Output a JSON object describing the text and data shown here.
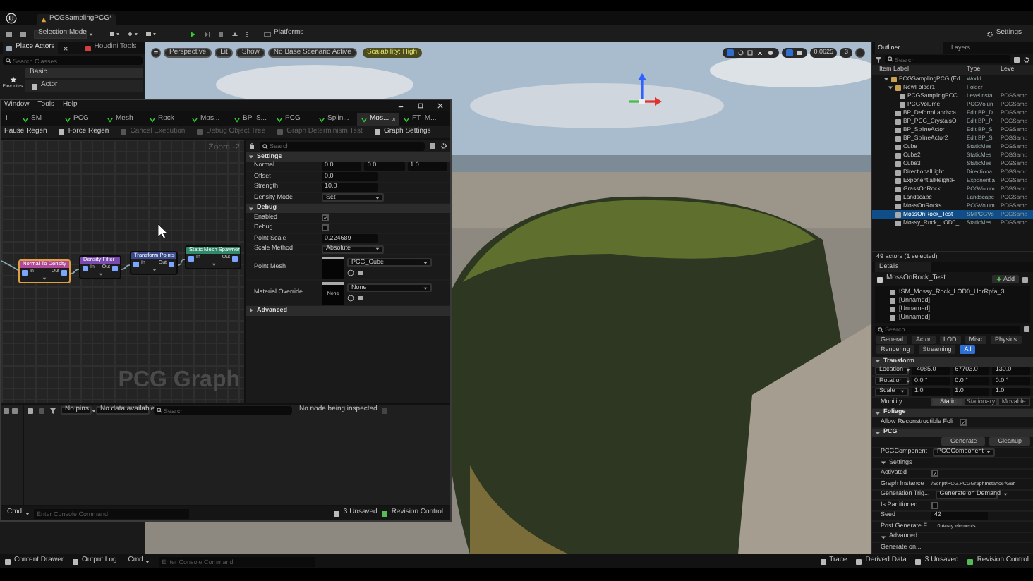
{
  "title_tab": "PCGSamplingPCG*",
  "toolbar": {
    "mode": "Selection Mode",
    "platforms": "Platforms",
    "settings": "Settings"
  },
  "place_actors": {
    "tabs": [
      {
        "label": "Place Actors",
        "selected": true
      },
      {
        "label": "Houdini Tools",
        "selected": false
      }
    ],
    "search": {
      "placeholder": "Search Classes"
    },
    "favorites": "Favorites",
    "category": "Basic",
    "item": "Actor"
  },
  "viewport": {
    "pills": [
      "Perspective",
      "Lit",
      "Show",
      "No Base Scenario Active"
    ],
    "scalability": "Scalability: High",
    "snap": "0.0625",
    "camera_speed": "3"
  },
  "pcg_window": {
    "menu": [
      "Window",
      "Tools",
      "Help"
    ],
    "tabs": [
      {
        "label": "I_",
        "selected": false
      },
      {
        "label": "SM_",
        "selected": false
      },
      {
        "label": "PCG_",
        "selected": false
      },
      {
        "label": "Mesh",
        "selected": false
      },
      {
        "label": "Rock",
        "selected": false
      },
      {
        "label": "Mos...",
        "selected": false
      },
      {
        "label": "BP_S...",
        "selected": false
      },
      {
        "label": "PCG_",
        "selected": false
      },
      {
        "label": "Splin...",
        "selected": false
      },
      {
        "label": "Mos...",
        "selected": true
      },
      {
        "label": "FT_M...",
        "selected": false
      }
    ],
    "toolbar": [
      {
        "label": "Pause Regen",
        "disabled": false
      },
      {
        "label": "Force Regen",
        "disabled": false
      },
      {
        "label": "Cancel Execution",
        "disabled": true
      },
      {
        "label": "Debug Object Tree",
        "disabled": true
      },
      {
        "label": "Graph Determinism Test",
        "disabled": true
      },
      {
        "label": "Graph Settings",
        "disabled": false
      }
    ],
    "zoom": "Zoom -2",
    "graph_label": "PCG Graph",
    "nodes": [
      {
        "title": "Normal To Density",
        "color": "#b04a98",
        "selected": true,
        "in": "In",
        "out": "Out"
      },
      {
        "title": "Density Filter",
        "color": "#7a4ab0",
        "selected": false,
        "in": "In",
        "out": "Out"
      },
      {
        "title": "Transform Points",
        "color": "#3a4a8a",
        "selected": false,
        "in": "In",
        "out": "Out"
      },
      {
        "title": "Static Mesh Spawner",
        "color": "#2f8a6a",
        "selected": false,
        "in": "In",
        "out": "Out"
      }
    ],
    "details": {
      "search": {
        "placeholder": "Search"
      },
      "sections": [
        {
          "title": "Settings",
          "expanded": true,
          "rows": [
            {
              "kind": "vector",
              "label": "Normal",
              "values": [
                "0.0",
                "0.0",
                "1.0"
              ]
            },
            {
              "kind": "number",
              "label": "Offset",
              "value": "0.0"
            },
            {
              "kind": "number",
              "label": "Strength",
              "value": "10.0"
            },
            {
              "kind": "dropdown",
              "label": "Density Mode",
              "value": "Set"
            }
          ]
        },
        {
          "title": "Debug",
          "expanded": true,
          "rows": [
            {
              "kind": "checkbox",
              "label": "Enabled",
              "checked": true
            },
            {
              "kind": "checkbox",
              "label": "Debug",
              "checked": false
            },
            {
              "kind": "number",
              "label": "Point Scale",
              "value": "0.224689"
            },
            {
              "kind": "dropdown",
              "label": "Scale Method",
              "value": "Absolute"
            },
            {
              "kind": "asset",
              "label": "Point Mesh",
              "value": "PCG_Cube"
            },
            {
              "kind": "asset",
              "label": "Material Override",
              "value": "None",
              "thumb": "None"
            }
          ]
        },
        {
          "title": "Advanced",
          "expanded": false
        }
      ]
    },
    "inspector": {
      "pins": "No pins",
      "data": "No data available",
      "search": {
        "placeholder": "Search"
      },
      "status": "No node being inspected"
    },
    "console": {
      "cmd": "Cmd",
      "placeholder": "Enter Console Command",
      "unsaved": "3 Unsaved",
      "revision": "Revision Control"
    }
  },
  "outliner": {
    "tabs": [
      {
        "label": "Outliner",
        "selected": true
      },
      {
        "label": "Layers",
        "selected": false
      }
    ],
    "search": {
      "placeholder": "Search"
    },
    "columns": [
      "Item Label",
      "Type",
      "Level"
    ],
    "rows": [
      {
        "label": "PCGSamplingPCG (Ed",
        "type": "World",
        "expanded": true,
        "selected": false,
        "children": [
          {
            "label": "NewFolder1",
            "type": "Folder",
            "expanded": true,
            "selected": false,
            "children": [
              {
                "label": "PCGSamplingPCC",
                "type": "LevelInsta",
                "level": "PCGSamp",
                "selected": false
              },
              {
                "label": "PCGVolume",
                "type": "PCGVolun",
                "level": "PCGSamp",
                "selected": false
              }
            ]
          },
          {
            "label": "BP_DeformLandsca",
            "type": "Edit BP_D",
            "level": "PCGSamp",
            "selected": false
          },
          {
            "label": "BP_PCG_CrystalsO",
            "type": "Edit BP_P",
            "level": "PCGSamp",
            "selected": false
          },
          {
            "label": "BP_SplineActor",
            "type": "Edit BP_S",
            "level": "PCGSamp",
            "selected": false
          },
          {
            "label": "BP_SplineActor2",
            "type": "Edit BP_S",
            "level": "PCGSamp",
            "selected": false
          },
          {
            "label": "Cube",
            "type": "StaticMes",
            "level": "PCGSamp",
            "selected": false
          },
          {
            "label": "Cube2",
            "type": "StaticMes",
            "level": "PCGSamp",
            "selected": false
          },
          {
            "label": "Cube3",
            "type": "StaticMes",
            "level": "PCGSamp",
            "selected": false
          },
          {
            "label": "DirectionalLight",
            "type": "Directiona",
            "level": "PCGSamp",
            "selected": false
          },
          {
            "label": "ExponentialHeightF",
            "type": "Exponentia",
            "level": "PCGSamp",
            "selected": false
          },
          {
            "label": "GrassOnRock",
            "type": "PCGVolum",
            "level": "PCGSamp",
            "selected": false
          },
          {
            "label": "Landscape",
            "type": "Landscape",
            "level": "PCGSamp",
            "selected": false
          },
          {
            "label": "MossOnRocks",
            "type": "PCGVolum",
            "level": "PCGSamp",
            "selected": false
          },
          {
            "label": "MossOnRock_Test",
            "type": "SMPCGVo",
            "level": "PCGSamp",
            "selected": true
          },
          {
            "label": "Mossy_Rock_LOD0_",
            "type": "StaticMes",
            "level": "PCGSamp",
            "selected": false
          }
        ]
      }
    ],
    "footer": "49 actors (1 selected)"
  },
  "details": {
    "tab": "Details",
    "actor": "MossOnRock_Test",
    "add": "Add",
    "components": [
      "ISM_Mossy_Rock_LOD0_UnrRpfa_3",
      "[Unnamed]",
      "[Unnamed]",
      "[Unnamed]"
    ],
    "search": {
      "placeholder": "Search"
    },
    "filters": [
      {
        "label": "General",
        "selected": false
      },
      {
        "label": "Actor",
        "selected": false
      },
      {
        "label": "LOD",
        "selected": false
      },
      {
        "label": "Misc",
        "selected": false
      },
      {
        "label": "Physics",
        "selected": false
      },
      {
        "label": "Rendering",
        "selected": false
      },
      {
        "label": "Streaming",
        "selected": false
      },
      {
        "label": "All",
        "selected": true
      }
    ],
    "sections": [
      {
        "title": "Transform",
        "expanded": true,
        "rows": [
          {
            "kind": "transform",
            "label": "Location",
            "values": [
              "-4085.0",
              "67703.0",
              "130.0"
            ]
          },
          {
            "kind": "transform",
            "label": "Rotation",
            "values": [
              "0.0 °",
              "0.0 °",
              "0.0 °"
            ]
          },
          {
            "kind": "transform",
            "label": "Scale",
            "values": [
              "1.0",
              "1.0",
              "1.0"
            ]
          },
          {
            "kind": "segmented",
            "label": "Mobility",
            "options": [
              {
                "label": "Static",
                "selected": true
              },
              {
                "label": "Stationary",
                "selected": false
              },
              {
                "label": "Movable",
                "selected": false
              }
            ]
          }
        ]
      },
      {
        "title": "Foliage",
        "expanded": true,
        "rows": [
          {
            "kind": "checkbox",
            "label": "Allow Reconstructible Foli",
            "checked": true
          }
        ]
      },
      {
        "title": "PCG",
        "expanded": true,
        "rows": [
          {
            "kind": "buttons",
            "buttons": [
              "Generate",
              "Cleanup"
            ]
          },
          {
            "kind": "dropdown",
            "label": "PCGComponent",
            "value": "PCGComponent"
          },
          {
            "kind": "subheader",
            "label": "Settings",
            "expanded": true
          },
          {
            "kind": "checkbox",
            "label": "Activated",
            "checked": true
          },
          {
            "kind": "text",
            "label": "Graph Instance",
            "value": "/Script/PCG.PCGGraphInstance'/Gen"
          },
          {
            "kind": "dropdown",
            "label": "Generation Trig...",
            "value": "Generate on Demand"
          },
          {
            "kind": "checkbox",
            "label": "Is Partitioned",
            "checked": false
          },
          {
            "kind": "number",
            "label": "Seed",
            "value": "42"
          },
          {
            "kind": "text",
            "label": "Post Generate F...",
            "value": "0 Array elements"
          },
          {
            "kind": "subheader",
            "label": "Advanced",
            "expanded": true
          },
          {
            "kind": "label",
            "label": "Generate on..."
          }
        ]
      }
    ]
  },
  "status_bar": {
    "left": [
      "Content Drawer",
      "Output Log"
    ],
    "cmd": "Cmd",
    "placeholder": "Enter Console Command",
    "right": [
      "Trace",
      "Derived Data",
      "3 Unsaved",
      "Revision Control"
    ]
  }
}
